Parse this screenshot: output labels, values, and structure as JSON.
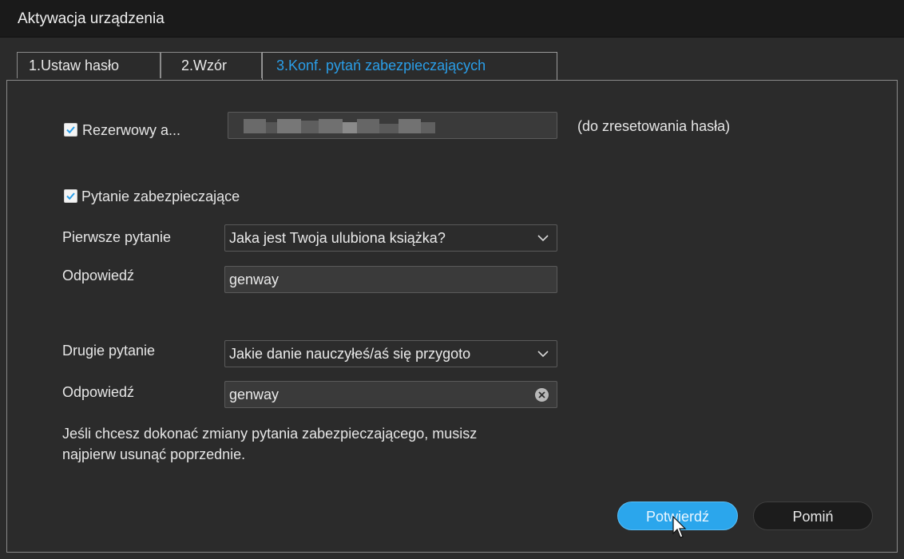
{
  "window": {
    "title": "Aktywacja urządzenia"
  },
  "tabs": [
    {
      "label": "1.Ustaw hasło",
      "active": false
    },
    {
      "label": "2.Wzór",
      "active": false
    },
    {
      "label": "3.Konf. pytań zabezpieczających",
      "active": true
    }
  ],
  "backup_email": {
    "checkbox_label": "Rezerwowy a...",
    "checked": true,
    "value_masked": true,
    "hint": "(do zresetowania hasła)"
  },
  "security_question": {
    "checkbox_label": "Pytanie zabezpieczające",
    "checked": true,
    "first_question_label": "Pierwsze pytanie",
    "first_question_value": "Jaka jest Twoja ulubiona książka?",
    "first_answer_label": "Odpowiedź",
    "first_answer_value": "genway",
    "second_question_label": "Drugie pytanie",
    "second_question_value": "Jakie danie nauczyłeś/aś się przygoto",
    "second_answer_label": "Odpowiedź",
    "second_answer_value": "genway"
  },
  "note": {
    "line1": "Jeśli chcesz dokonać zmiany pytania zabezpieczającego, musisz",
    "line2": "najpierw usunąć poprzednie."
  },
  "buttons": {
    "confirm": "Potwierdź",
    "skip": "Pomiń"
  },
  "colors": {
    "accent": "#2ba6ec",
    "active_tab_text": "#2a9ee8",
    "background": "#2b2b2b",
    "titlebar": "#1a1a1a"
  }
}
